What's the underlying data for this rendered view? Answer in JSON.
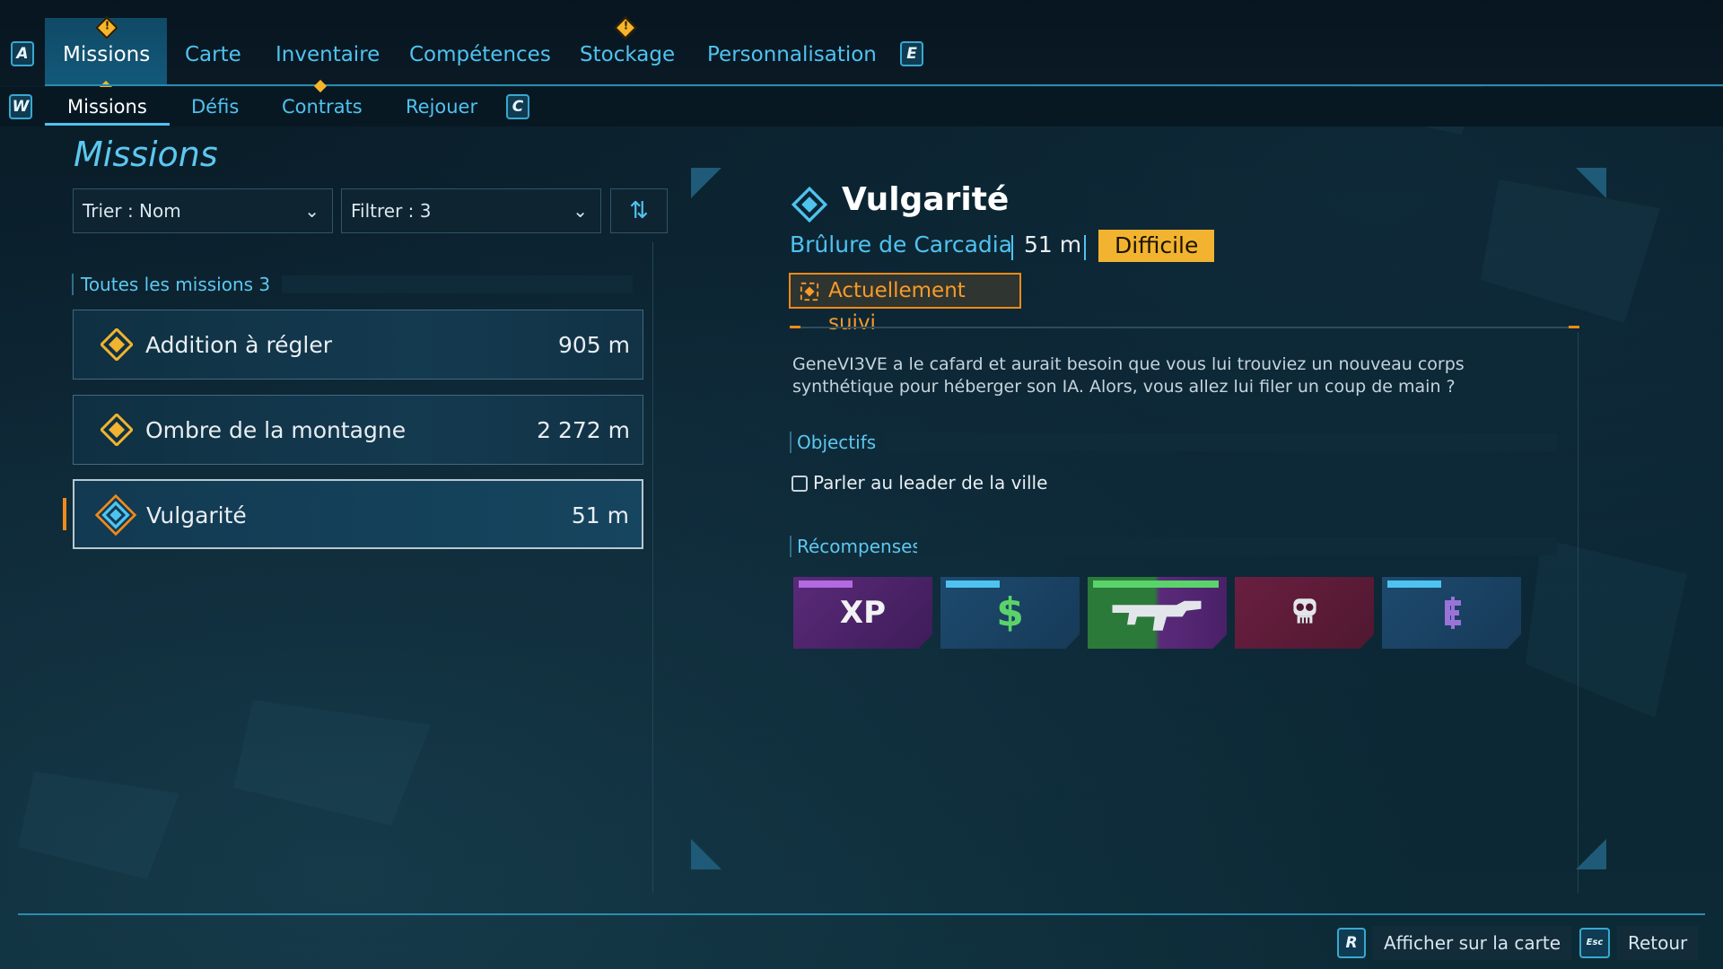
{
  "topnav": {
    "key_left": "A",
    "key_right": "E",
    "tabs": [
      {
        "label": "Missions",
        "active": true
      },
      {
        "label": "Carte"
      },
      {
        "label": "Inventaire"
      },
      {
        "label": "Compétences"
      },
      {
        "label": "Stockage"
      },
      {
        "label": "Personnalisation"
      }
    ]
  },
  "subnav": {
    "key_left": "W",
    "key_right": "C",
    "tabs": [
      {
        "label": "Missions",
        "active": true
      },
      {
        "label": "Défis"
      },
      {
        "label": "Contrats"
      },
      {
        "label": "Rejouer"
      }
    ]
  },
  "left": {
    "title": "Missions",
    "sort_label": "Trier : Nom",
    "filter_label": "Filtrer : 3",
    "list_header": "Toutes les missions 3",
    "missions": [
      {
        "name": "Addition à régler",
        "distance": "905 m"
      },
      {
        "name": "Ombre de la montagne",
        "distance": "2 272 m"
      },
      {
        "name": "Vulgarité",
        "distance": "51 m",
        "selected": true
      }
    ]
  },
  "detail": {
    "title": "Vulgarité",
    "location": "Brûlure de Carcadia",
    "distance": "51 m",
    "difficulty": "Difficile",
    "tracked": "Actuellement suivi",
    "description": "GeneVI3VE a le cafard et aurait besoin que vous lui trouviez un nouveau corps synthétique pour héberger son IA. Alors, vous allez lui filer un coup de main ?",
    "objectives_header": "Objectifs",
    "objectives": [
      "Parler au leader de la ville"
    ],
    "rewards_header": "Récompenses",
    "rewards": [
      {
        "icon": "xp-icon",
        "label": "XP",
        "color": "#5a2a7a"
      },
      {
        "icon": "money-icon",
        "label": "$",
        "color": "#1d4a6e"
      },
      {
        "icon": "weapon-icon",
        "label": "",
        "color": "#2b7a3a"
      },
      {
        "icon": "skull-icon",
        "label": "",
        "color": "#6a1f40"
      },
      {
        "icon": "eridium-icon",
        "label": "",
        "color": "#1d4a6e"
      }
    ]
  },
  "bottom": {
    "map_key": "R",
    "map_label": "Afficher sur la carte",
    "back_key": "Esc",
    "back_label": "Retour"
  },
  "colors": {
    "accent": "#4fc3f0",
    "warning": "#f2b330",
    "tracked": "#f08a1a"
  }
}
